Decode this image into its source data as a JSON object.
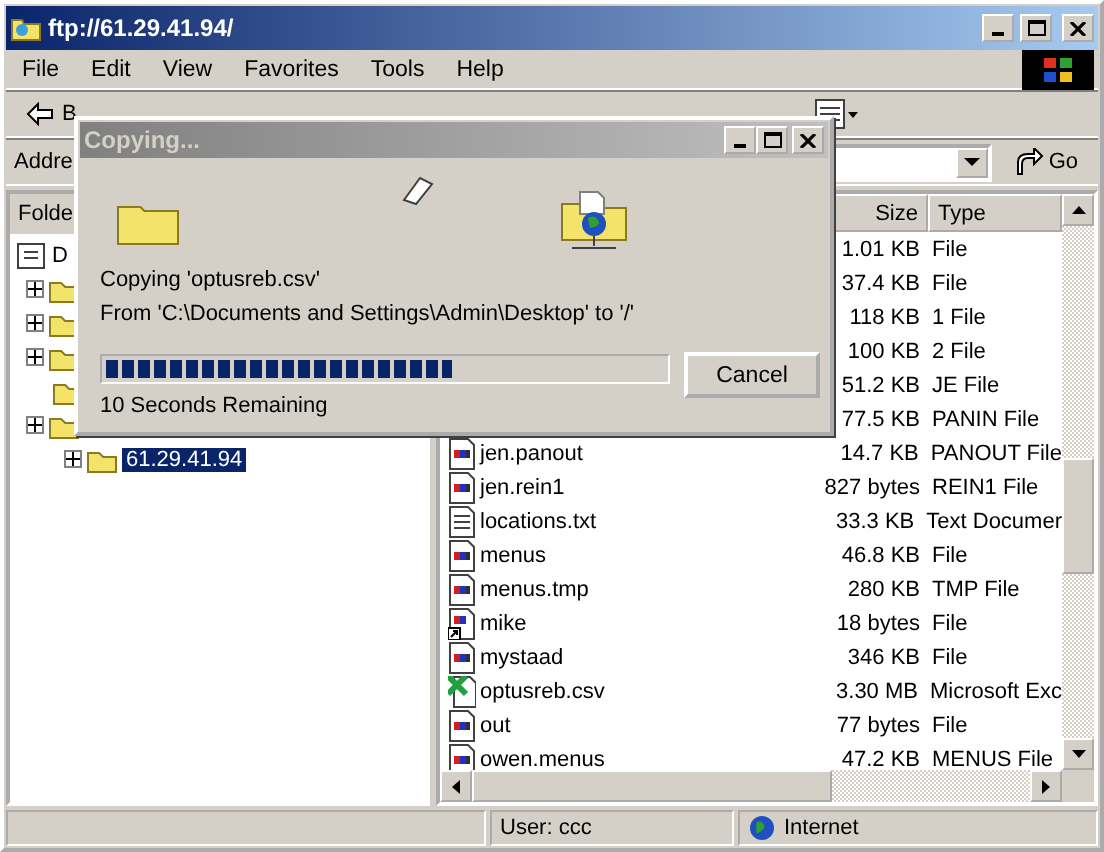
{
  "window": {
    "title": "ftp://61.29.41.94/"
  },
  "menu": [
    "File",
    "Edit",
    "View",
    "Favorites",
    "Tools",
    "Help"
  ],
  "toolbar": {
    "back_label": "B"
  },
  "address": {
    "label": "Addre",
    "go": "Go"
  },
  "folders_pane": {
    "title": "Folde",
    "tree": [
      {
        "label": "D",
        "expandable": false,
        "selected": false,
        "children": [
          {
            "expandable": true
          },
          {
            "expandable": true
          },
          {
            "expandable": true
          },
          {
            "expandable": false
          },
          {
            "expandable": true,
            "children": [
              {
                "label": "61.29.41.94",
                "expandable": true,
                "selected": true
              }
            ]
          }
        ]
      }
    ]
  },
  "files": {
    "columns": [
      "Size",
      "Type"
    ],
    "rows": [
      {
        "size": "1.01 KB",
        "type": "File"
      },
      {
        "size": "37.4 KB",
        "type": "File"
      },
      {
        "size": "118 KB",
        "type": "1 File"
      },
      {
        "size": "100 KB",
        "type": "2 File"
      },
      {
        "size": "51.2 KB",
        "type": "JE File"
      },
      {
        "size": "77.5 KB",
        "type": "PANIN File"
      },
      {
        "kind": "file",
        "name": "jen.panout",
        "size": "14.7 KB",
        "type": "PANOUT File"
      },
      {
        "kind": "file",
        "name": "jen.rein1",
        "size": "827 bytes",
        "type": "REIN1 File"
      },
      {
        "kind": "text",
        "name": "locations.txt",
        "size": "33.3 KB",
        "type": "Text Documer"
      },
      {
        "kind": "file",
        "name": "menus",
        "size": "46.8 KB",
        "type": "File"
      },
      {
        "kind": "file",
        "name": "menus.tmp",
        "size": "280 KB",
        "type": "TMP File"
      },
      {
        "kind": "shortcut",
        "name": "mike",
        "size": "18 bytes",
        "type": "File"
      },
      {
        "kind": "file",
        "name": "mystaad",
        "size": "346 KB",
        "type": "File"
      },
      {
        "kind": "excel",
        "name": "optusreb.csv",
        "size": "3.30 MB",
        "type": "Microsoft Exc"
      },
      {
        "kind": "file",
        "name": "out",
        "size": "77 bytes",
        "type": "File"
      },
      {
        "kind": "file",
        "name": "owen.menus",
        "size": "47.2 KB",
        "type": "MENUS File"
      }
    ]
  },
  "status_bar": [
    "User: ccc",
    "Internet"
  ],
  "dialog": {
    "title": "Copying...",
    "message": "Copying 'optusreb.csv'",
    "detail": "From 'C:\\Documents and Settings\\Admin\\Desktop' to '/'",
    "level": 0.62,
    "remaining": "10 Seconds Remaining",
    "button": "Cancel"
  }
}
